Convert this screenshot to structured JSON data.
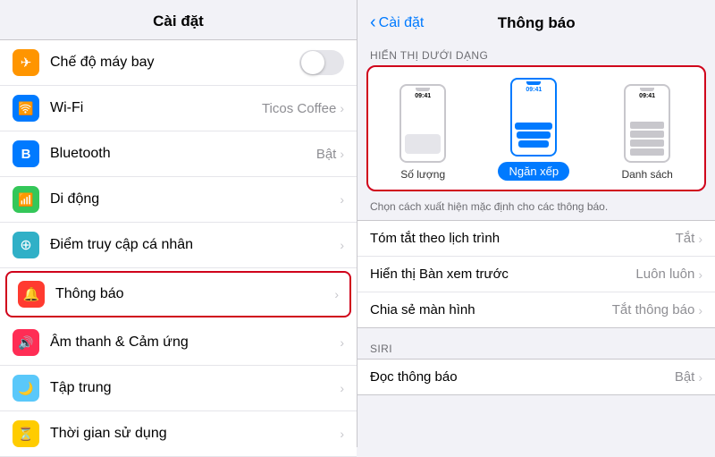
{
  "left": {
    "title": "Cài đặt",
    "items": [
      {
        "id": "airplane",
        "label": "Chế độ máy bay",
        "icon": "✈",
        "iconClass": "icon-orange",
        "type": "toggle",
        "value": ""
      },
      {
        "id": "wifi",
        "label": "Wi-Fi",
        "icon": "📶",
        "iconClass": "icon-blue",
        "type": "value",
        "value": "Ticos Coffee"
      },
      {
        "id": "bluetooth",
        "label": "Bluetooth",
        "icon": "B",
        "iconClass": "icon-bluetooth",
        "type": "value",
        "value": "Bật"
      },
      {
        "id": "mobile",
        "label": "Di động",
        "icon": "📡",
        "iconClass": "icon-green",
        "type": "chevron",
        "value": ""
      },
      {
        "id": "personal-hotspot",
        "label": "Điểm truy cập cá nhân",
        "icon": "⊕",
        "iconClass": "icon-teal",
        "type": "chevron",
        "value": ""
      },
      {
        "id": "notifications",
        "label": "Thông báo",
        "icon": "🔔",
        "iconClass": "icon-red",
        "type": "chevron",
        "value": "",
        "highlighted": true
      },
      {
        "id": "sound",
        "label": "Âm thanh & Cảm ứng",
        "icon": "🔊",
        "iconClass": "icon-red2",
        "type": "chevron",
        "value": ""
      },
      {
        "id": "focus",
        "label": "Tập trung",
        "icon": "🌙",
        "iconClass": "icon-indigo",
        "type": "chevron",
        "value": ""
      },
      {
        "id": "screen-time",
        "label": "Thời gian sử dụng",
        "icon": "⏳",
        "iconClass": "icon-yellow",
        "type": "chevron",
        "value": ""
      }
    ]
  },
  "right": {
    "back_label": "Cài đặt",
    "title": "Thông báo",
    "section_display": "HIỂN THỊ DƯỚI DẠNG",
    "display_options": [
      {
        "id": "count",
        "label": "Số lượng",
        "selected": false
      },
      {
        "id": "stack",
        "label": "Ngăn xếp",
        "selected": true
      },
      {
        "id": "list",
        "label": "Danh sách",
        "selected": false
      }
    ],
    "hint": "Chọn cách xuất hiện mặc định cho các thông báo.",
    "section_siri": "SIRI",
    "settings": [
      {
        "id": "schedule",
        "label": "Tóm tắt theo lịch trình",
        "value": "Tắt"
      },
      {
        "id": "preview",
        "label": "Hiển thị Bàn xem trước",
        "value": "Luôn luôn"
      },
      {
        "id": "share",
        "label": "Chia sẻ màn hình",
        "value": "Tắt thông báo"
      }
    ],
    "siri_items": [
      {
        "id": "read-notif",
        "label": "Đọc thông báo",
        "value": "Bật"
      }
    ],
    "time": "09:41"
  }
}
